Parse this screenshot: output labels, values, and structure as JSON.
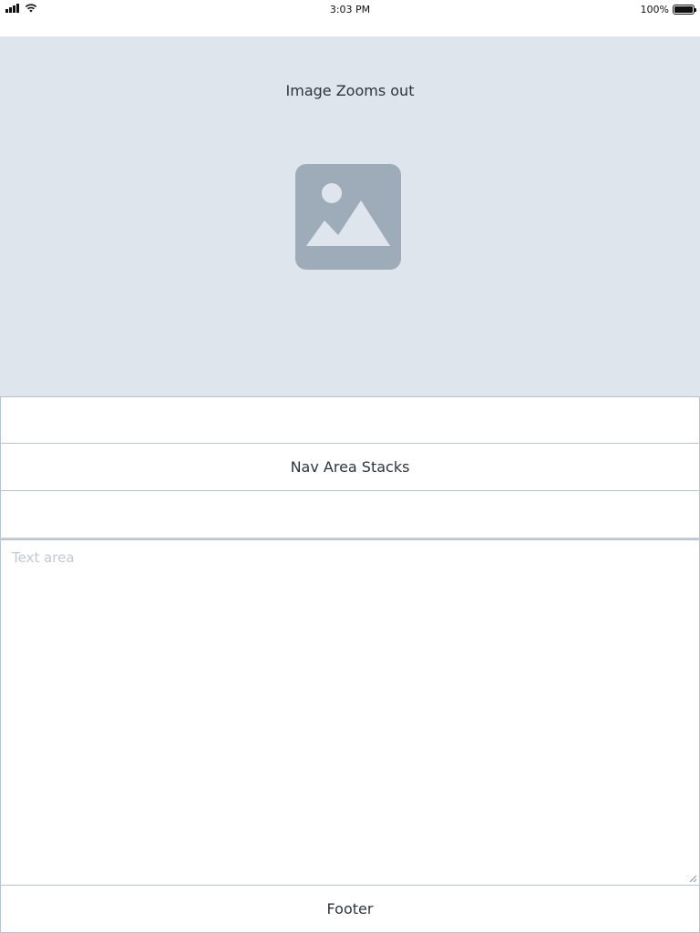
{
  "status_bar": {
    "time": "3:03 PM",
    "battery": "100%",
    "icons": [
      "signal-icon",
      "wifi-icon",
      "battery-icon"
    ]
  },
  "hero": {
    "title": "Image Zooms out",
    "image_icon": "image-placeholder-icon",
    "background": "#dfe5ec",
    "icon_color": "#9eacb9"
  },
  "nav": {
    "rows": [
      {
        "label": ""
      },
      {
        "label": "Nav Area Stacks"
      },
      {
        "label": ""
      }
    ]
  },
  "text_area": {
    "placeholder": "Text area",
    "value": ""
  },
  "footer": {
    "label": "Footer"
  }
}
